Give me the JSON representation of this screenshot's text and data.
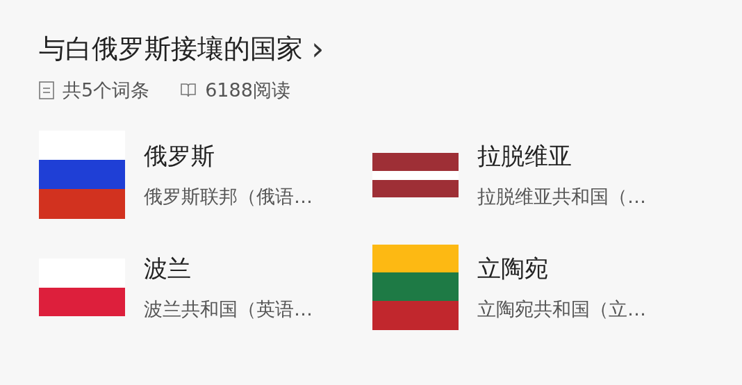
{
  "title": "与白俄罗斯接壤的国家",
  "title_arrow": "›",
  "meta": [
    {
      "kind": "entries",
      "text": "共5个词条"
    },
    {
      "kind": "reads",
      "text": "6188阅读"
    }
  ],
  "items": [
    {
      "kind": "russia",
      "name": "俄罗斯",
      "description": "俄罗斯联邦（俄语…"
    },
    {
      "kind": "latvia",
      "name": "拉脱维亚",
      "description": "拉脱维亚共和国（…"
    },
    {
      "kind": "poland",
      "name": "波兰",
      "description": "波兰共和国（英语…"
    },
    {
      "kind": "lithuania",
      "name": "立陶宛",
      "description": "立陶宛共和国（立…"
    }
  ]
}
